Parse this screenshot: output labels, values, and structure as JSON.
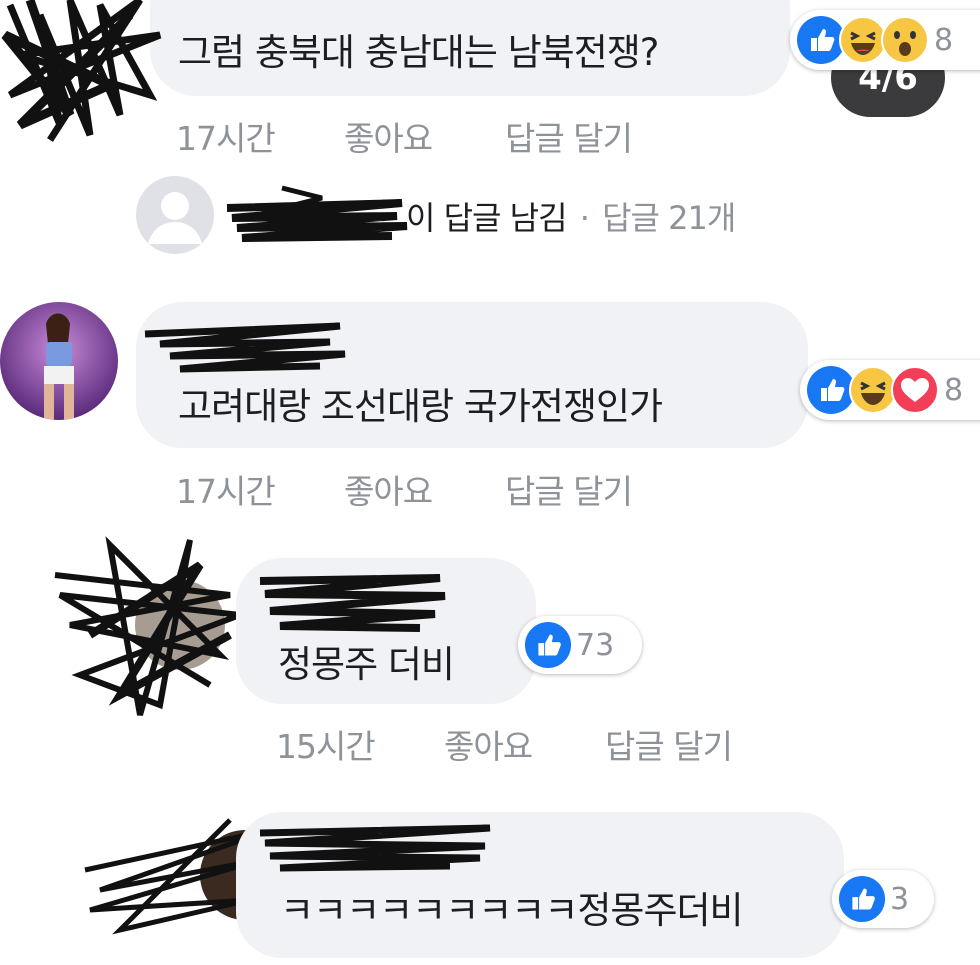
{
  "pager": {
    "label": "4/6"
  },
  "comments": [
    {
      "text": "그럼 충북대 충남대는 남북전쟁?",
      "time": "17시간",
      "like": "좋아요",
      "reply": "답글 달기",
      "reaction_count": "8",
      "reactions": [
        "like-icon",
        "haha-icon",
        "wow-icon"
      ]
    },
    {
      "text": "고려대랑 조선대랑 국가전쟁인가",
      "time": "17시간",
      "like": "좋아요",
      "reply": "답글 달기",
      "reaction_count": "8",
      "reactions": [
        "like-icon",
        "haha-icon",
        "love-icon"
      ]
    },
    {
      "text": "정몽주 더비",
      "time": "15시간",
      "like": "좋아요",
      "reply": "답글 달기",
      "reaction_count": "73",
      "reactions": [
        "like-icon"
      ]
    },
    {
      "text": "ㅋㅋㅋㅋㅋㅋㅋㅋㅋ정몽주더비",
      "reaction_count": "3",
      "reactions": [
        "like-icon"
      ]
    }
  ],
  "replies_summary": {
    "left_reply_text": "이 답글 남김",
    "separator": "·",
    "reply_count_text": "답글 21개"
  },
  "colors": {
    "like_blue": "#1877f2",
    "haha_yellow": "#f7c744",
    "love_red": "#f33e58",
    "bubble_bg": "#f1f2f6",
    "meta_gray": "#8e9299"
  }
}
